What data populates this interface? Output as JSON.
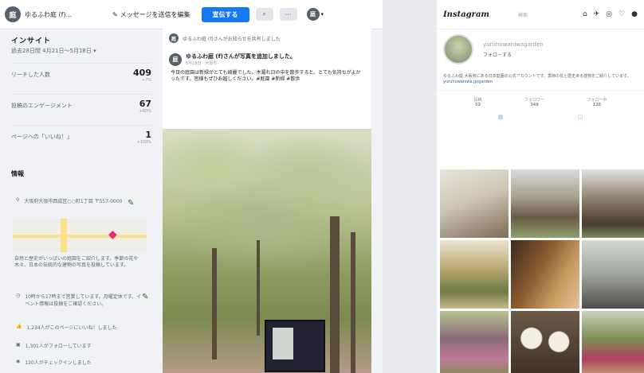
{
  "facebook": {
    "page_name": "ゆるふわ庭 (f)...",
    "edit_link": "メッセージを送信を編集",
    "promote_button": "宣伝する",
    "insights": {
      "title": "インサイト",
      "period": "過去28日間 4月21日〜5月18日 ▾",
      "metrics": [
        {
          "label": "リーチした人数",
          "value": "409",
          "sub": "+7%"
        },
        {
          "label": "投稿のエンゲージメント",
          "value": "67",
          "sub": "+60%"
        },
        {
          "label": "ページへの「いいね！」",
          "value": "1",
          "sub": "+100%"
        }
      ]
    },
    "info": {
      "title": "情報",
      "address": "大阪府大阪市西成区○○町1丁目 〒557-0000",
      "description": "自然と歴史がいっぱいの庭園をご紹介します。季節の花や木々、日本の伝統的な建物の写真を投稿しています。",
      "hours_text": "10時から17時まで営業しています。月曜定休です。イベント情報は投稿をご確認ください。",
      "row1": "1,234人がこのページにいいね！しました",
      "row2": "1,301人がフォローしています",
      "row3": "120人がチェックインしました"
    },
    "post": {
      "share_text": "ゆるふわ庭 (f)さんがお知らせを共有しました",
      "author": "ゆるふわ庭 (f)さんが写真を追加しました。",
      "meta": "5月18日 · 大阪市 ·",
      "body": "今日の庭園は新緑がとても綺麗でした。木漏れ日の中を散歩すると、とても気持ちがよかったです。皆様もぜひお越しください。#庭園 #新緑 #散歩"
    }
  },
  "instagram": {
    "logo": "Instagram",
    "search": "検索",
    "username": "yuruhuwaniwagarden",
    "follow_button": "フォローする",
    "bio": "ゆるふわ庭\n大阪府にある日本庭園の公式アカウントです。季節の花と歴史ある建物をご紹介しています。",
    "link": "yuruhuwaniwa.jp/garden",
    "stats": [
      {
        "label": "投稿",
        "value": "52"
      },
      {
        "label": "フォロワー",
        "value": "349"
      },
      {
        "label": "フォロー中",
        "value": "120"
      }
    ]
  },
  "colors": {
    "fb_blue": "#1877f2",
    "ig_pink": "#e1306c"
  }
}
